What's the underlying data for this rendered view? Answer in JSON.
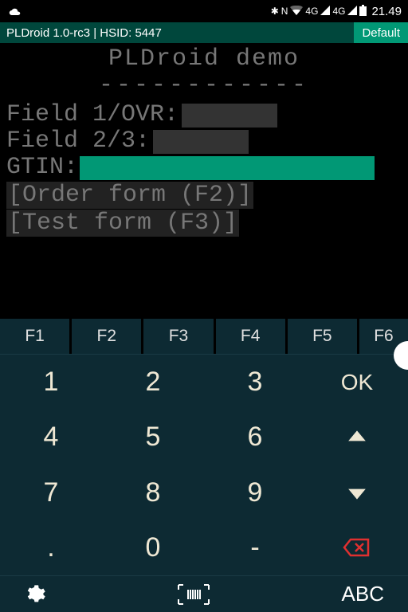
{
  "status": {
    "time": "21.49",
    "net1": "4G",
    "net2": "4G"
  },
  "header": {
    "title": "PLDroid 1.0-rc3 | HSID: 5447",
    "mode": "Default"
  },
  "terminal": {
    "title": "PLDroid demo",
    "dashes": "------------",
    "field1_label": "Field 1/OVR:",
    "field2_label": "Field 2/3:",
    "gtin_label": "GTIN:",
    "link1": "[Order form (F2)]",
    "link2": "[Test form (F3)]"
  },
  "fkeys": [
    "F1",
    "F2",
    "F3",
    "F4",
    "F5",
    "F6"
  ],
  "numpad": {
    "keys": [
      "1",
      "2",
      "3",
      "OK",
      "4",
      "5",
      "6",
      "↑",
      "7",
      "8",
      "9",
      "↓",
      ".",
      "0",
      "-",
      "⌫"
    ]
  },
  "bottom": {
    "abc": "ABC"
  }
}
